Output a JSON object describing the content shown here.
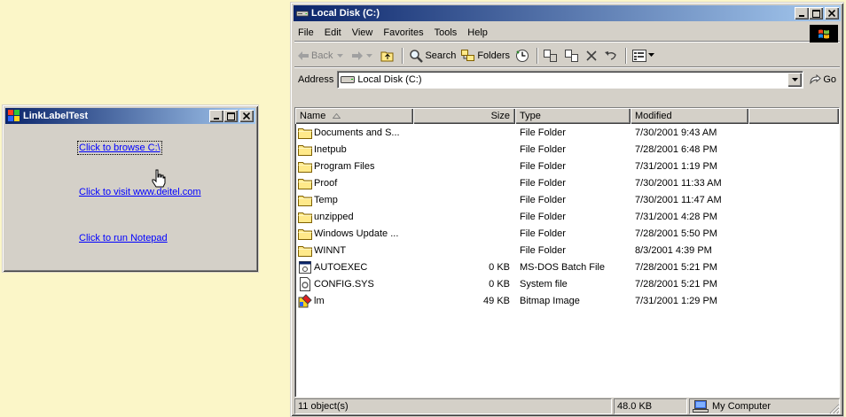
{
  "link_window": {
    "title": "LinkLabelTest",
    "links": [
      "Click to browse C:\\",
      "Click to visit www.deitel.com",
      "Click to run Notepad"
    ]
  },
  "explorer": {
    "title": "Local Disk (C:)",
    "menu": [
      "File",
      "Edit",
      "View",
      "Favorites",
      "Tools",
      "Help"
    ],
    "toolbar": {
      "back": "Back",
      "search": "Search",
      "folders": "Folders"
    },
    "address": {
      "label": "Address",
      "value": "Local Disk (C:)",
      "go": "Go"
    },
    "columns": [
      "Name",
      "Size",
      "Type",
      "Modified"
    ],
    "files": [
      {
        "icon": "folder-icon",
        "name": "Documents and S...",
        "size": "",
        "type": "File Folder",
        "modified": "7/30/2001 9:43 AM"
      },
      {
        "icon": "folder-icon",
        "name": "Inetpub",
        "size": "",
        "type": "File Folder",
        "modified": "7/28/2001 6:48 PM"
      },
      {
        "icon": "folder-icon",
        "name": "Program Files",
        "size": "",
        "type": "File Folder",
        "modified": "7/31/2001 1:19 PM"
      },
      {
        "icon": "folder-icon",
        "name": "Proof",
        "size": "",
        "type": "File Folder",
        "modified": "7/30/2001 11:33 AM"
      },
      {
        "icon": "folder-icon",
        "name": "Temp",
        "size": "",
        "type": "File Folder",
        "modified": "7/30/2001 11:47 AM"
      },
      {
        "icon": "folder-icon",
        "name": "unzipped",
        "size": "",
        "type": "File Folder",
        "modified": "7/31/2001 4:28 PM"
      },
      {
        "icon": "folder-icon",
        "name": "Windows Update ...",
        "size": "",
        "type": "File Folder",
        "modified": "7/28/2001 5:50 PM"
      },
      {
        "icon": "folder-icon",
        "name": "WINNT",
        "size": "",
        "type": "File Folder",
        "modified": "8/3/2001 4:39 PM"
      },
      {
        "icon": "batch-file-icon",
        "name": "AUTOEXEC",
        "size": "0 KB",
        "type": "MS-DOS Batch File",
        "modified": "7/28/2001 5:21 PM"
      },
      {
        "icon": "system-file-icon",
        "name": "CONFIG.SYS",
        "size": "0 KB",
        "type": "System file",
        "modified": "7/28/2001 5:21 PM"
      },
      {
        "icon": "bitmap-icon",
        "name": "lm",
        "size": "49 KB",
        "type": "Bitmap Image",
        "modified": "7/31/2001 1:29 PM"
      }
    ],
    "status": {
      "count": "11 object(s)",
      "size": "48.0 KB",
      "zone": "My Computer"
    }
  }
}
